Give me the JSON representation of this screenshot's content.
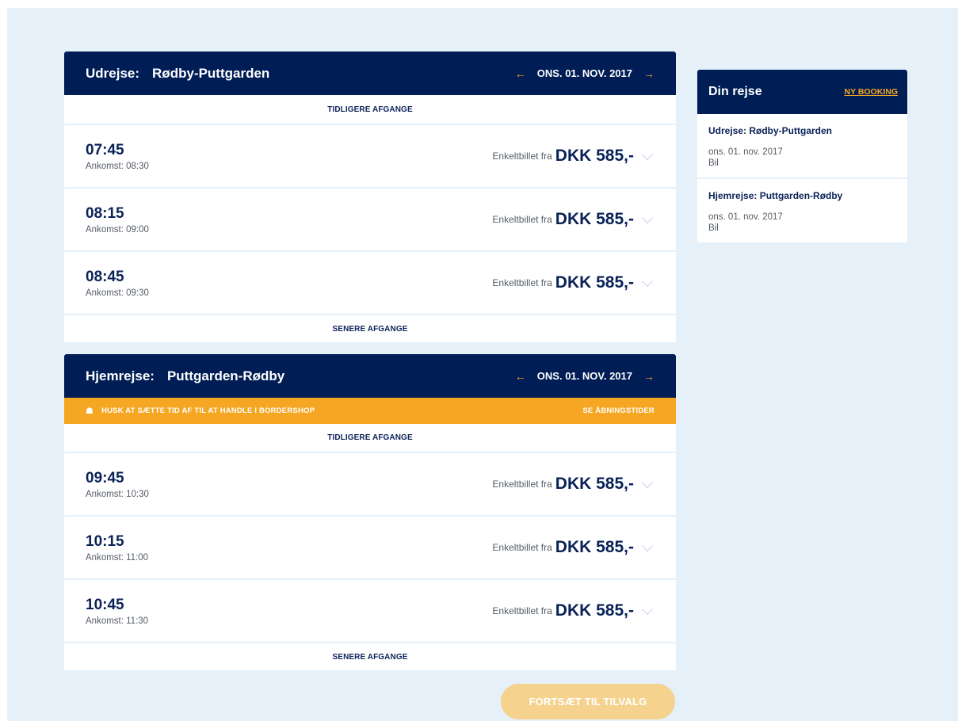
{
  "outbound": {
    "trip_type": "Udrejse:",
    "route": "Rødby-Puttgarden",
    "date": "ONS. 01. NOV. 2017",
    "earlier": "TIDLIGERE AFGANGE",
    "later": "SENERE AFGANGE",
    "departures": [
      {
        "time": "07:45",
        "arrival": "Ankomst: 08:30",
        "price_label": "Enkeltbillet fra",
        "price": "DKK 585,-"
      },
      {
        "time": "08:15",
        "arrival": "Ankomst: 09:00",
        "price_label": "Enkeltbillet fra",
        "price": "DKK 585,-"
      },
      {
        "time": "08:45",
        "arrival": "Ankomst: 09:30",
        "price_label": "Enkeltbillet fra",
        "price": "DKK 585,-"
      }
    ]
  },
  "homebound": {
    "trip_type": "Hjemrejse:",
    "route": "Puttgarden-Rødby",
    "date": "ONS. 01. NOV. 2017",
    "notice": "HUSK AT SÆTTE TID AF TIL AT HANDLE I BORDERSHOP",
    "notice_link": "SE ÅBNINGSTIDER",
    "earlier": "TIDLIGERE AFGANGE",
    "later": "SENERE AFGANGE",
    "departures": [
      {
        "time": "09:45",
        "arrival": "Ankomst: 10:30",
        "price_label": "Enkeltbillet fra",
        "price": "DKK 585,-"
      },
      {
        "time": "10:15",
        "arrival": "Ankomst: 11:00",
        "price_label": "Enkeltbillet fra",
        "price": "DKK 585,-"
      },
      {
        "time": "10:45",
        "arrival": "Ankomst: 11:30",
        "price_label": "Enkeltbillet fra",
        "price": "DKK 585,-"
      }
    ]
  },
  "continue_label": "FORTSÆT TIL TILVALG",
  "summary": {
    "title": "Din rejse",
    "new_booking": "NY BOOKING",
    "legs": [
      {
        "title": "Udrejse: Rødby-Puttgarden",
        "date": "ons. 01. nov. 2017",
        "vehicle": "Bil"
      },
      {
        "title": "Hjemrejse: Puttgarden-Rødby",
        "date": "ons. 01. nov. 2017",
        "vehicle": "Bil"
      }
    ]
  },
  "icons": {
    "prev": "arrow-left-icon",
    "next": "arrow-right-icon",
    "expand": "chevron-down-icon",
    "notice": "basket-icon"
  },
  "colors": {
    "navy": "#001e55",
    "accent": "#f5a623",
    "background": "#e6f0f9",
    "continue_disabled": "#f5d28e"
  }
}
